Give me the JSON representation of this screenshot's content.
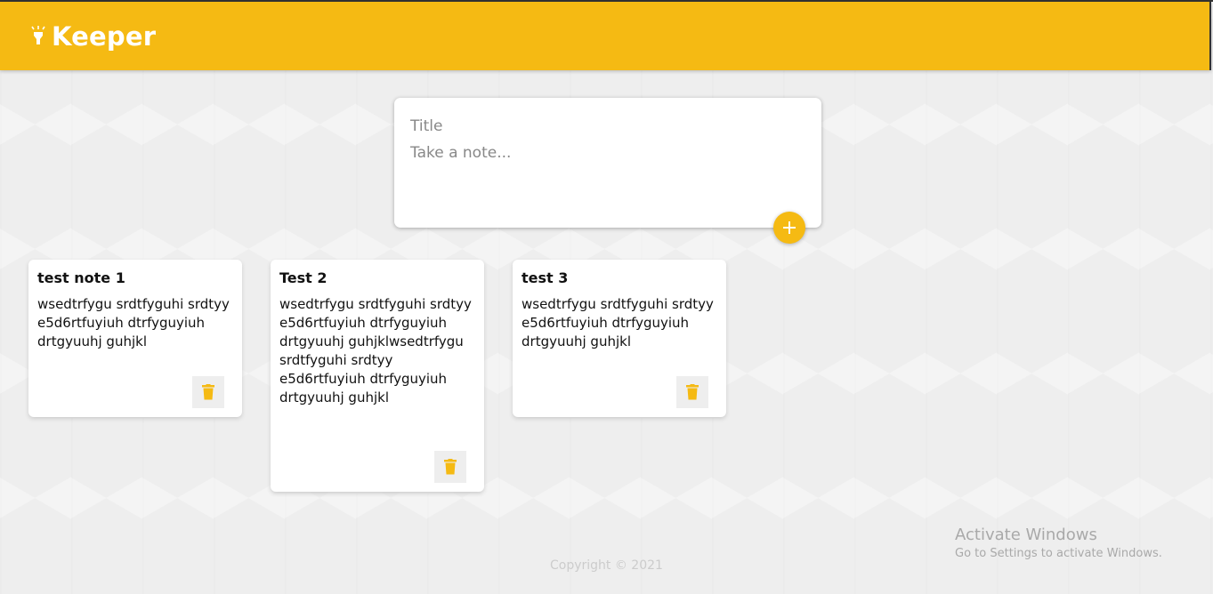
{
  "header": {
    "app_name": "Keeper",
    "logo_icon": "lightbulb-icon",
    "brand_color": "#f5ba13"
  },
  "create_note": {
    "title_placeholder": "Title",
    "content_placeholder": "Take a note...",
    "add_icon": "plus-icon"
  },
  "notes": [
    {
      "title": "test note 1",
      "content": "wsedtrfygu srdtfyguhi srdtyy e5d6rtfuyiuh dtrfyguyiuh drtgyuuhj guhjkl",
      "delete_icon": "trash-icon"
    },
    {
      "title": "Test 2",
      "content": "wsedtrfygu srdtfyguhi srdtyy e5d6rtfuyiuh dtrfyguyiuh drtgyuuhj guhjklwsedtrfygu srdtfyguhi srdtyy e5d6rtfuyiuh dtrfyguyiuh drtgyuuhj guhjkl",
      "delete_icon": "trash-icon"
    },
    {
      "title": "test 3",
      "content": "wsedtrfygu srdtfyguhi srdtyy e5d6rtfuyiuh dtrfyguyiuh drtgyuuhj guhjkl",
      "delete_icon": "trash-icon"
    }
  ],
  "footer": {
    "copyright": "Copyright © 2021"
  },
  "os_watermark": {
    "line1": "Activate Windows",
    "line2": "Go to Settings to activate Windows."
  }
}
